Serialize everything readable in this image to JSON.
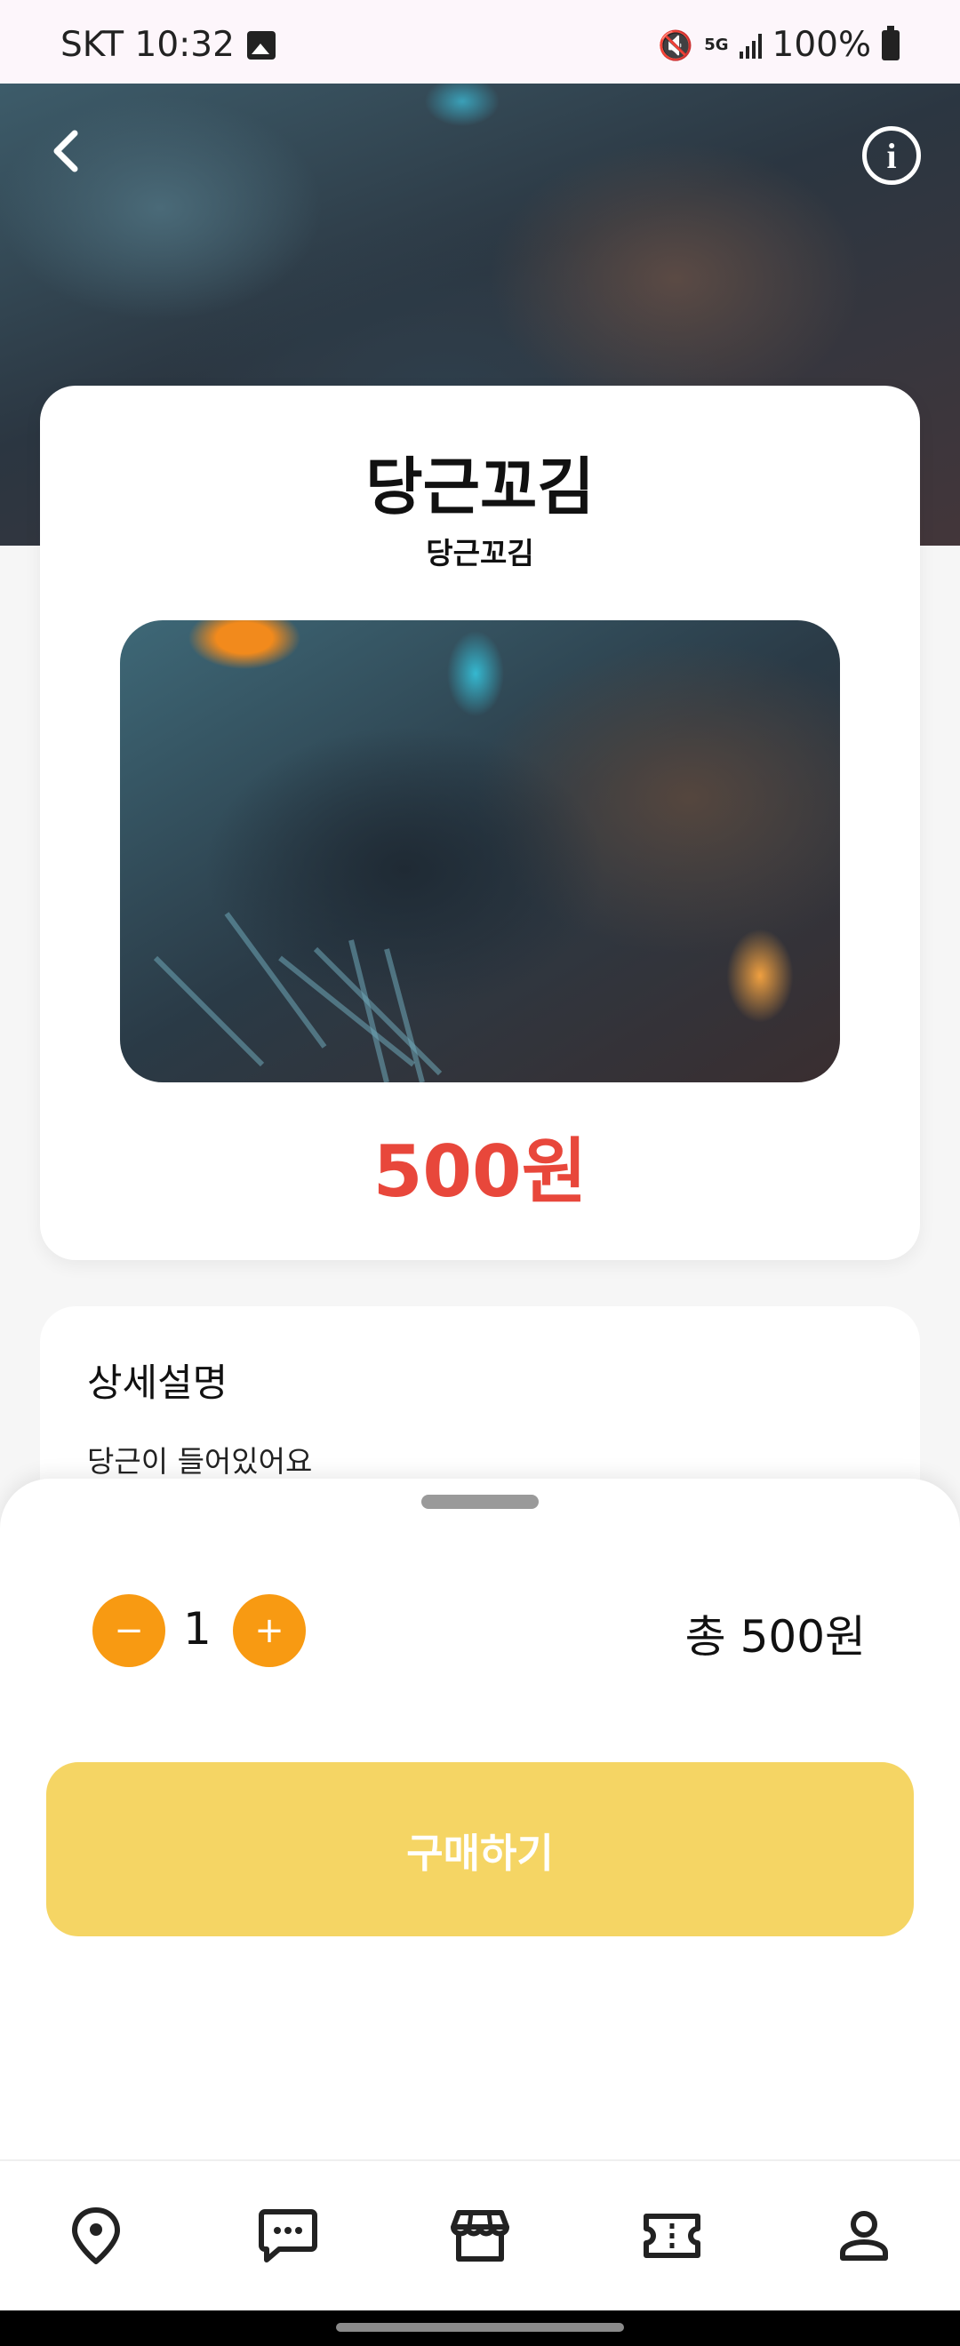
{
  "status_bar": {
    "carrier_time": "SKT 10:32",
    "network": "5G",
    "battery": "100%"
  },
  "product": {
    "title": "당근꼬김",
    "subtitle": "당근꼬김",
    "price": "500원"
  },
  "description": {
    "heading": "상세설명",
    "text": "당근이 들어있어요"
  },
  "order": {
    "minus_label": "−",
    "plus_label": "+",
    "quantity": "1",
    "total": "총 500원",
    "buy_label": "구매하기"
  },
  "nav": {
    "items": [
      "map-pin-icon",
      "chat-icon",
      "store-icon",
      "ticket-icon",
      "profile-icon"
    ]
  },
  "colors": {
    "accent_orange": "#f89a12",
    "price_red": "#e8473b",
    "buy_yellow": "#f5d564"
  }
}
